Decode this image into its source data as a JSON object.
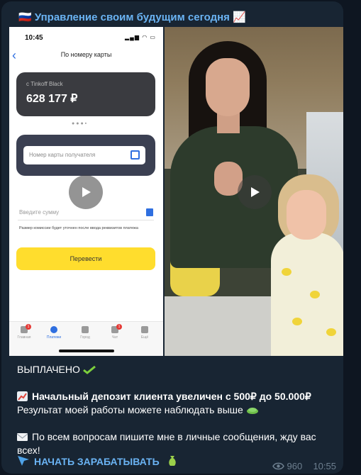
{
  "channel": {
    "title": "🇷🇺 Управление своим будущим сегодня 📈"
  },
  "phone": {
    "time": "10:45",
    "header": "По номеру карты",
    "card_label": "с Tinkoff Black",
    "card_balance": "628 177 ₽",
    "recipient_placeholder": "Номер карты получателя",
    "amount_placeholder": "Введите сумму",
    "commission_note": "Размер комиссии будет уточнен после ввода реквизитов платежа",
    "transfer_button": "Перевести",
    "tabs": [
      "Главная",
      "Платежи",
      "Город",
      "Чат",
      "Ещё"
    ]
  },
  "message": {
    "line1": "ВЫПЛАЧЕНО",
    "line2": "Начальный депозит клиента увеличен с 500₽ до 50.000₽",
    "line3": "Результат моей работы можете наблюдать выше",
    "line4": "По всем вопросам пишите мне в личные сообщения, жду вас всех!",
    "link": "НАЧАТЬ ЗАРАБАТЫВАТЬ",
    "views": "960",
    "time": "10:55"
  },
  "colors": {
    "link": "#6ab3f3",
    "bubble": "#182533",
    "background": "#0e1621",
    "accent_yellow": "#ffdd2d"
  },
  "icons": [
    "play-icon",
    "eye-icon",
    "chart-up-icon",
    "check-mark-icon",
    "envelope-icon",
    "pointer-icon"
  ]
}
